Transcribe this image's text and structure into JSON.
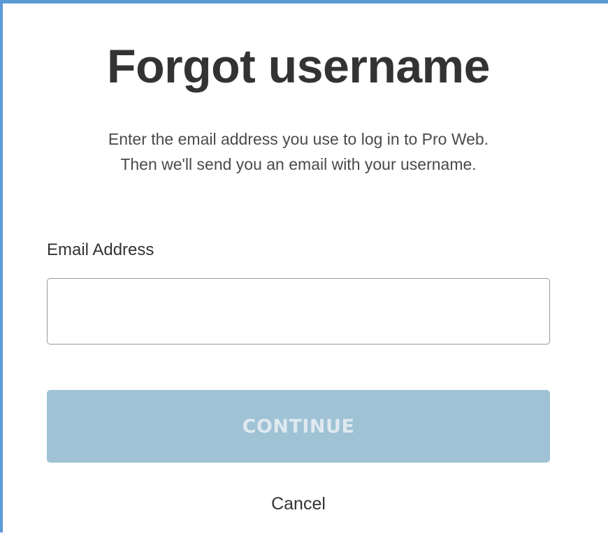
{
  "page": {
    "title": "Forgot username",
    "description_line1": "Enter the email address you use to log in to Pro Web.",
    "description_line2": "Then we'll send you an email with your username."
  },
  "form": {
    "email_label": "Email Address",
    "email_value": "",
    "email_placeholder": "",
    "continue_label": "CONTINUE",
    "continue_disabled": true,
    "cancel_label": "Cancel"
  },
  "colors": {
    "frame_border": "#5b9bd5",
    "button_disabled_bg": "#9fc2d5",
    "button_disabled_text": "#dfe9ef",
    "text_primary": "#333333"
  }
}
